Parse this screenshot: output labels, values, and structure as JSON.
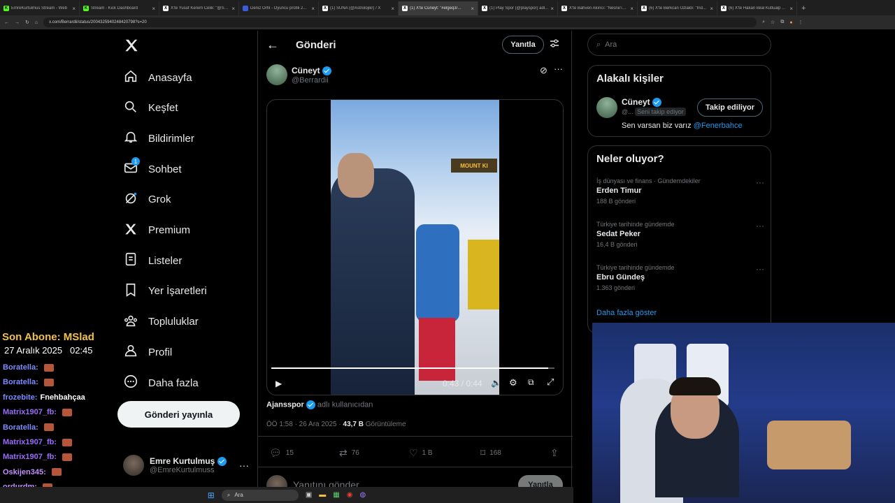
{
  "browser": {
    "tabs": [
      {
        "title": "EmreKurtulmus Stream - Web",
        "color": "#53fc18",
        "letter": "K"
      },
      {
        "title": "Stream - Kick Dashboard",
        "color": "#53fc18",
        "letter": "K"
      },
      {
        "title": "X'te Yusuf Kerem Celik: \"@Sa...",
        "color": "#ffffff",
        "letter": "X"
      },
      {
        "title": "Deniz Orhl - Oyuncu profili 2...",
        "color": "#3b5bdb",
        "letter": ""
      },
      {
        "title": "(1) SUNA (@Astrolojikr) / X",
        "color": "#ffffff",
        "letter": "X"
      },
      {
        "title": "(1) X'te Cüneyt: \"#elgeq3/...",
        "color": "#ffffff",
        "letter": "X"
      },
      {
        "title": "(1) Play Spor (@playspor) adl...",
        "color": "#ffffff",
        "letter": "X"
      },
      {
        "title": "X'te Bahven Akıncı: \"Nesne'ın iç...",
        "color": "#ffffff",
        "letter": "X"
      },
      {
        "title": "(6) X'te Berkcan Özlaldı: \"Ind...",
        "color": "#ffffff",
        "letter": "X"
      },
      {
        "title": "(6) X'te Hakan Bilal Kutlualp ...",
        "color": "#ffffff",
        "letter": "X"
      }
    ],
    "url": "x.com/Berrardii/status/2004325940248420798?s=20"
  },
  "nav": {
    "items": [
      {
        "label": "Anasayfa",
        "icon": "home-icon"
      },
      {
        "label": "Keşfet",
        "icon": "search-icon"
      },
      {
        "label": "Bildirimler",
        "icon": "bell-icon"
      },
      {
        "label": "Sohbet",
        "icon": "mail-icon",
        "badge": "1"
      },
      {
        "label": "Grok",
        "icon": "grok-icon"
      },
      {
        "label": "Premium",
        "icon": "x-logo-icon"
      },
      {
        "label": "Listeler",
        "icon": "list-icon"
      },
      {
        "label": "Yer İşaretleri",
        "icon": "bookmark-icon"
      },
      {
        "label": "Topluluklar",
        "icon": "communities-icon"
      },
      {
        "label": "Profil",
        "icon": "profile-icon"
      },
      {
        "label": "Daha fazla",
        "icon": "more-circle-icon"
      }
    ],
    "post_button": "Gönderi yayınla",
    "account": {
      "name": "Emre Kurtulmuş",
      "handle": "@EmreKurtulmuss"
    }
  },
  "post": {
    "header_title": "Gönderi",
    "reply_button": "Yanıtla",
    "author_name": "Cüneyt",
    "author_handle": "@Berrardii",
    "video": {
      "time": "0:43 / 0:44",
      "progress": 0.977,
      "sign_text": "MOUNT KI"
    },
    "source_name": "Ajansspor",
    "source_suffix": "adlı kullanıcıdan",
    "timestamp": "ÖÖ 1:58 · 26 Ara 2025 ·",
    "views": "43,7 B",
    "views_label": "Görüntüleme",
    "stats": {
      "replies": "15",
      "reposts": "76",
      "likes": "1 B",
      "bookmarks": "168"
    },
    "reply_placeholder": "Yanıtını gönder",
    "reply_submit": "Yanıtla"
  },
  "sidebar": {
    "search_placeholder": "Ara",
    "related_title": "Alakalı kişiler",
    "related": {
      "name": "Cüneyt",
      "handle": "@...",
      "follows_you": "Seni takip ediyor",
      "follow_button": "Takip ediliyor",
      "bio_text": "Sen varsan biz varız",
      "bio_link": "@Fenerbahce"
    },
    "trends_title": "Neler oluyor?",
    "trends": [
      {
        "context": "İş dünyası ve finans · Gündemdekiler",
        "name": "Erden Timur",
        "count": "188 B gönderi"
      },
      {
        "context": "Türkiye tarihinde gündemde",
        "name": "Sedat Peker",
        "count": "16,4 B gönderi"
      },
      {
        "context": "Türkiye tarihinde gündemde",
        "name": "Ebru Gündeş",
        "count": "1.363 gönderi"
      }
    ],
    "show_more": "Daha fazla göster"
  },
  "overlay": {
    "last_sub_label": "Son Abone: MSlad",
    "date": "27 Aralık 2025",
    "time": "02:45",
    "chat": [
      {
        "user": "Boratella:",
        "msg": "",
        "color": "#7b8cff"
      },
      {
        "user": "Boratella:",
        "msg": "",
        "color": "#7b8cff"
      },
      {
        "user": "frozebite:",
        "msg": "Fnehbahçaa",
        "color": "#7b8cff"
      },
      {
        "user": "Matrix1907_fb:",
        "msg": "",
        "color": "#9a6bff"
      },
      {
        "user": "Boratella:",
        "msg": "",
        "color": "#7b8cff"
      },
      {
        "user": "Matrix1907_fb:",
        "msg": "",
        "color": "#9a6bff"
      },
      {
        "user": "Matrix1907_fb:",
        "msg": "",
        "color": "#9a6bff"
      },
      {
        "user": "Oskijen345:",
        "msg": "",
        "color": "#c58cff"
      },
      {
        "user": "ordurdm:",
        "msg": "",
        "color": "#c58cff"
      }
    ]
  },
  "taskbar": {
    "search_placeholder": "Ara"
  }
}
